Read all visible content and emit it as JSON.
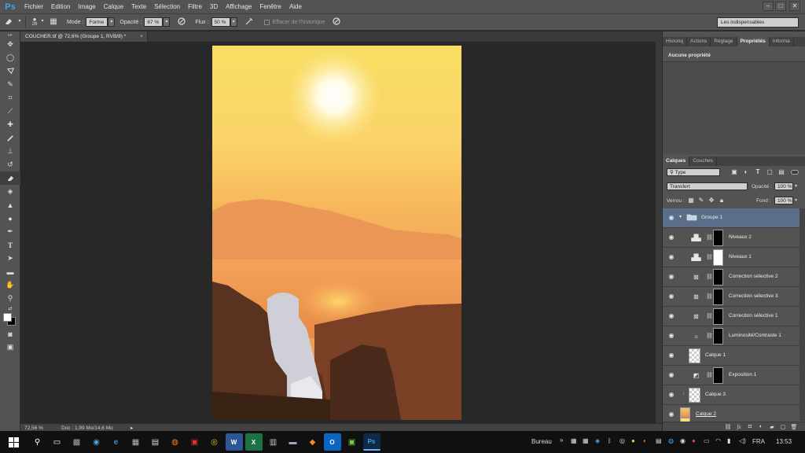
{
  "app": {
    "logo": "Ps"
  },
  "menu": [
    "Fichier",
    "Edition",
    "Image",
    "Calque",
    "Texte",
    "Sélection",
    "Filtre",
    "3D",
    "Affichage",
    "Fenêtre",
    "Aide"
  ],
  "window_controls": {
    "minimize": "–",
    "maximize": "□",
    "close": "✕"
  },
  "options": {
    "brush_size": "26",
    "mode_label": "Mode :",
    "mode_value": "Forme",
    "opacity_label": "Opacité :",
    "opacity_value": "67 %",
    "flow_label": "Flux :",
    "flow_value": "50 %",
    "erase_history": "Effacer de l'historique",
    "workspace": "Les indispensables"
  },
  "document": {
    "tab_title": "COUCHER.tif @ 72,6% (Groupe 1, RVB/8) *",
    "close": "×",
    "zoom": "72,56 %",
    "doc_info": "Doc : 1,99 Mo/14,6 Mo"
  },
  "panels": {
    "top_tabs": [
      "Historiq",
      "Actions",
      "Réglage",
      "Propriétés",
      "Informa"
    ],
    "top_active": 3,
    "properties_empty": "Aucune propriété",
    "layer_tabs": [
      "Calques",
      "Couches"
    ],
    "layer_active": 0,
    "filter_type": "Type",
    "blend_mode": "Transfert",
    "opacity_label": "Opacité :",
    "opacity_value": "100 %",
    "lock_label": "Verrou :",
    "fill_label": "Fond :",
    "fill_value": "100 %"
  },
  "layers": [
    {
      "name": "Groupe 1",
      "kind": "group",
      "selected": true
    },
    {
      "name": "Niveaux 2",
      "kind": "levels",
      "mask": "black"
    },
    {
      "name": "Niveaux 1",
      "kind": "levels",
      "mask": "white"
    },
    {
      "name": "Correction sélective 2",
      "kind": "selective",
      "mask": "black"
    },
    {
      "name": "Correction sélective 3",
      "kind": "selective",
      "mask": "black"
    },
    {
      "name": "Correction sélective 1",
      "kind": "selective",
      "mask": "black"
    },
    {
      "name": "Luminosité/Contraste 1",
      "kind": "brightness",
      "mask": "black"
    },
    {
      "name": "Calque 1",
      "kind": "pixel"
    },
    {
      "name": "Exposition 1",
      "kind": "exposure",
      "mask": "black"
    },
    {
      "name": "Calque 3",
      "kind": "pixel"
    },
    {
      "name": "Calque 2",
      "kind": "photo"
    }
  ],
  "taskbar": {
    "desktop_label": "Bureau",
    "chevron": "»",
    "language": "FRA",
    "time": "13:53"
  },
  "colors": {
    "accent": "#3fa4e8",
    "layer_selected": "#5a6e8a"
  }
}
